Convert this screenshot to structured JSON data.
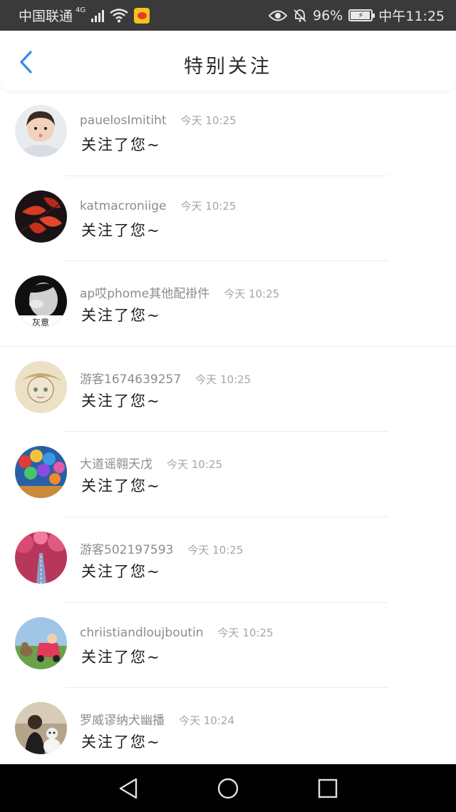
{
  "status_bar": {
    "carrier": "中国联通",
    "network": "4G",
    "battery": "96%",
    "time": "中午11:25"
  },
  "header": {
    "title": "特别关注",
    "accent_color": "#2e8fe6"
  },
  "items": [
    {
      "username": "pauelosImitiht",
      "time": "今天 10:25",
      "message": "关注了您~"
    },
    {
      "username": "katmacroniige",
      "time": "今天 10:25",
      "message": "关注了您~"
    },
    {
      "username": "ap哎phome其他配褂件",
      "time": "今天 10:25",
      "message": "关注了您~",
      "avatar_overlay": "灰意"
    },
    {
      "username": "游客1674639257",
      "time": "今天 10:25",
      "message": "关注了您~"
    },
    {
      "username": "大道谣翱天戊",
      "time": "今天 10:25",
      "message": "关注了您~"
    },
    {
      "username": "游客502197593",
      "time": "今天 10:25",
      "message": "关注了您~"
    },
    {
      "username": "chriistiandloujboutin",
      "time": "今天 10:25",
      "message": "关注了您~"
    },
    {
      "username": "罗威谬纳犬幽播",
      "time": "今天 10:24",
      "message": "关注了您~"
    }
  ],
  "nav": {
    "back_icon": "triangle-back",
    "home_icon": "circle-home",
    "recents_icon": "square-recents"
  }
}
